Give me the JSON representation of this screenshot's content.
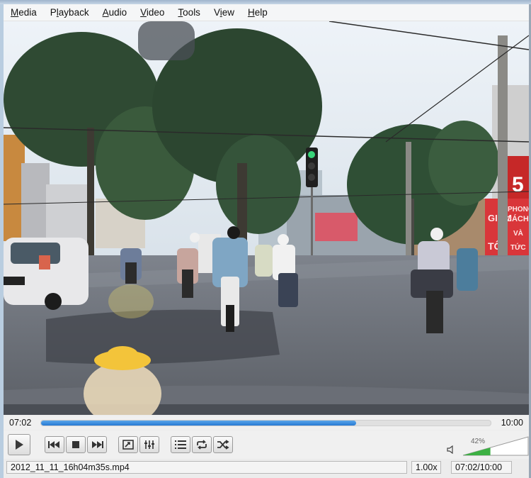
{
  "menu": [
    "Media",
    "Playback",
    "Audio",
    "Video",
    "Tools",
    "View",
    "Help"
  ],
  "menu_mnemonics": [
    "M",
    "l",
    "A",
    "V",
    "T",
    "i",
    "H"
  ],
  "video_scene": {
    "sign_partial_number": "5",
    "sign_partial_text_1": "GIAM",
    "sign_partial_text_2": "TÔI",
    "sign_partial_text_3": "PHONG",
    "sign_partial_text_4": "CÁCH",
    "sign_partial_text_5": "VÀ",
    "sign_partial_text_6": "TỨC"
  },
  "seek": {
    "elapsed": "07:02",
    "total": "10:00",
    "progress": 0.7
  },
  "controls": {
    "play": "play-icon",
    "prev": "previous-icon",
    "stop": "stop-icon",
    "next": "next-icon",
    "fullscreen": "fullscreen-icon",
    "extended": "equalizer-icon",
    "playlist": "playlist-icon",
    "loop": "loop-icon",
    "shuffle": "shuffle-icon"
  },
  "volume": {
    "percent_label": "42%",
    "level": 0.42
  },
  "status": {
    "filename": "2012_11_11_16h04m35s.mp4",
    "speed": "1.00x",
    "time": "07:02/10:00"
  },
  "colors": {
    "progress": "#2f86dc",
    "volume": "#3cb043"
  }
}
